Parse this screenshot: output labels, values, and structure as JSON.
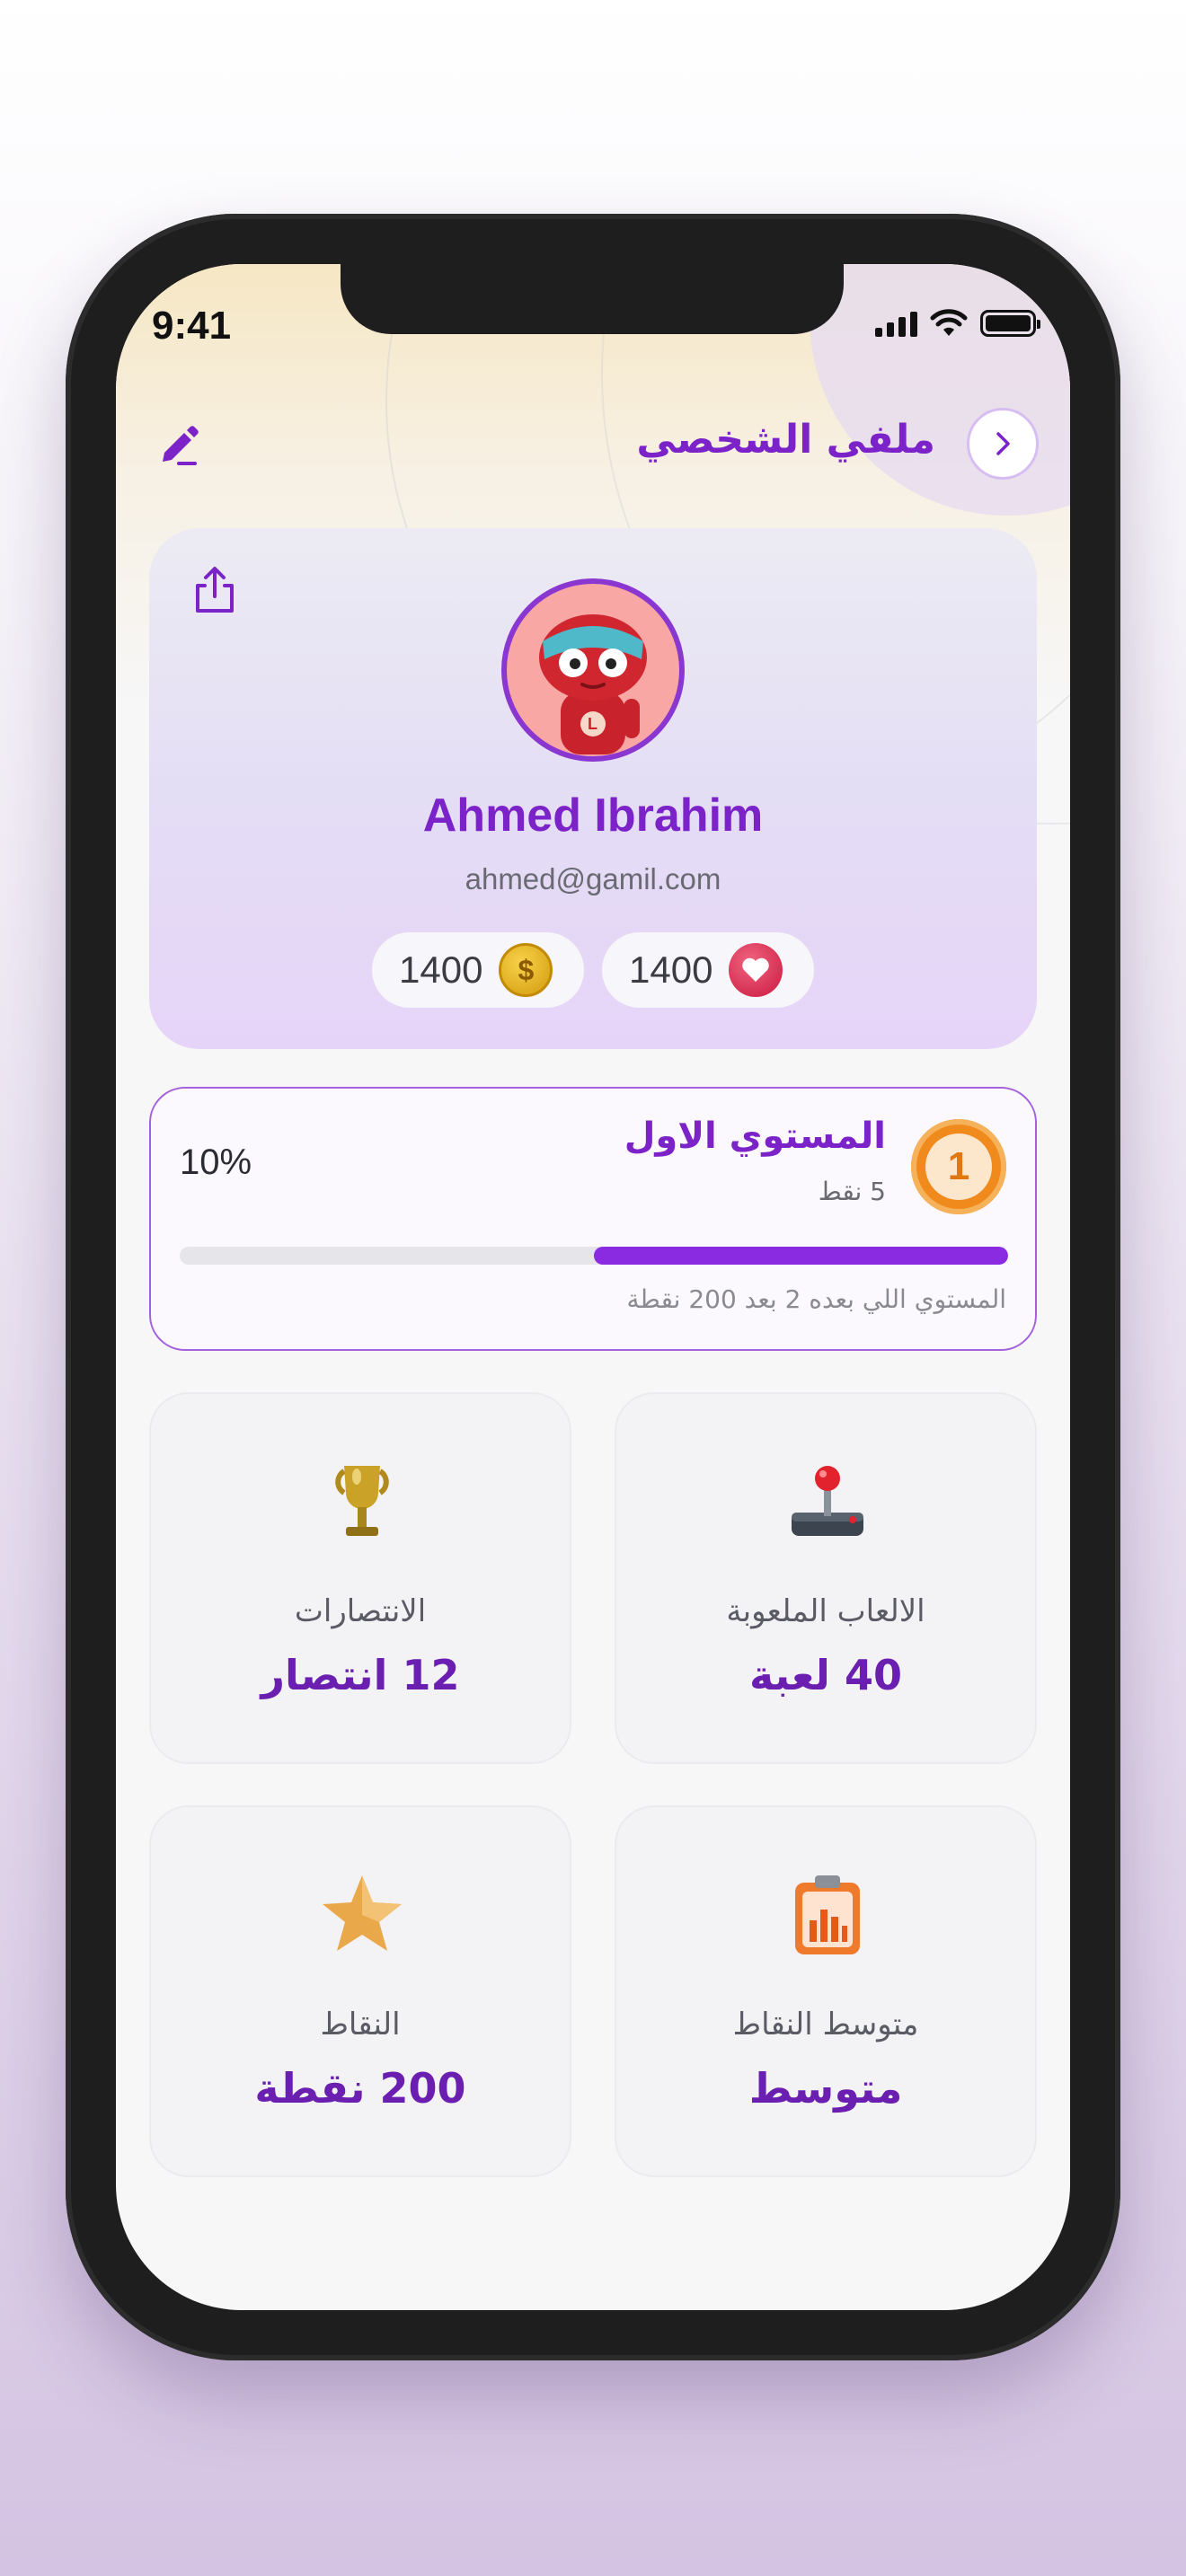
{
  "status_bar": {
    "time": "9:41"
  },
  "header": {
    "title": "ملفي الشخصي"
  },
  "profile": {
    "name": "Ahmed Ibrahim",
    "email": "ahmed@gamil.com",
    "coins": "1400",
    "hearts": "1400"
  },
  "level": {
    "title": "المستوي الاول",
    "number": "1",
    "points": "5 نقط",
    "percent_label": "10%",
    "progress": 0.5,
    "next_level_text": "المستوي اللي بعده 2 بعد 200 نقطة"
  },
  "stats": [
    {
      "label": "الالعاب الملعوبة",
      "value": "40 لعبة",
      "icon": "joystick-icon"
    },
    {
      "label": "الانتصارات",
      "value": "12 انتصار",
      "icon": "trophy-icon"
    },
    {
      "label": "متوسط النقاط",
      "value": "متوسط",
      "icon": "clipboard-chart-icon"
    },
    {
      "label": "النقاط",
      "value": "200 نقطة",
      "icon": "star-icon"
    }
  ],
  "colors": {
    "accent": "#7b22c8",
    "progress": "#8a2be2",
    "badge": "#f08a1c"
  }
}
